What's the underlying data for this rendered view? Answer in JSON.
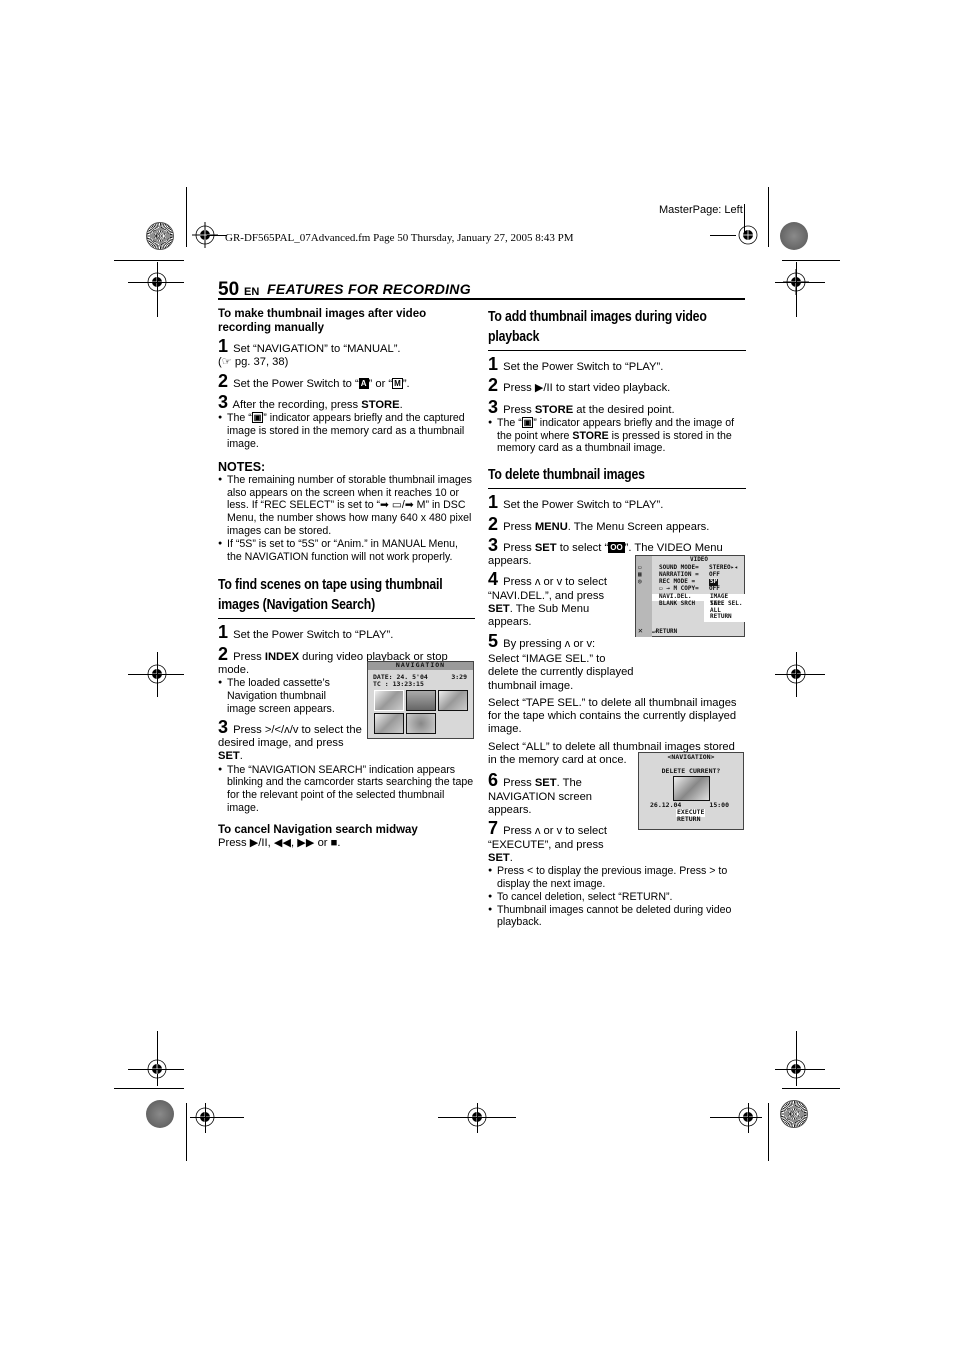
{
  "print_marks": {
    "masterpage": "MasterPage: Left",
    "file_info": "GR-DF565PAL_07Advanced.fm  Page 50  Thursday, January 27, 2005  8:43 PM"
  },
  "header": {
    "page_number": "50",
    "language": "EN",
    "section_title": "FEATURES FOR RECORDING"
  },
  "left_column": {
    "manual": {
      "title": "To make thumbnail images after video recording manually",
      "steps": [
        {
          "num": "1",
          "text": "Set “NAVIGATION” to “MANUAL”.",
          "ref": "(☞ pg. 37, 38)"
        },
        {
          "num": "2",
          "text_before": "Set the Power Switch to “",
          "icon1": "A",
          "text_mid": "” or “",
          "icon2": "M",
          "text_after": "”."
        },
        {
          "num": "3",
          "text_before": "After the recording, press ",
          "bold": "STORE",
          "text_after": "."
        }
      ],
      "bullet": {
        "text_before": "The “",
        "icon": "▣",
        "text_after": "” indicator appears briefly and the captured image is stored in the memory card as a thumbnail image."
      }
    },
    "notes": {
      "title": "NOTES:",
      "items": [
        "The remaining number of storable thumbnail images also appears on the screen when it reaches 10 or less. If “REC SELECT” is set to “➡ ▭/➡ M” in DSC Menu, the number shows how many 640 x 480 pixel images can be stored.",
        "If “5S” is set to “5S” or “Anim.” in MANUAL Menu, the NAVIGATION function will not work properly."
      ]
    },
    "navigation_search": {
      "title": "To find scenes on tape using thumbnail images (Navigation Search)",
      "step1": {
        "num": "1",
        "text": "Set the Power Switch to “PLAY”."
      },
      "step2": {
        "num": "2",
        "text_before": "Press ",
        "bold": "INDEX",
        "text_after": " during video playback or stop mode."
      },
      "bullet1": "The loaded cassette’s Navigation thumbnail image screen appears.",
      "step3": {
        "num": "3",
        "text_before": "Press >/</ʌ/v to select the desired image, and press ",
        "bold": "SET",
        "text_after": "."
      },
      "bullet2": "The “NAVIGATION SEARCH” indication appears blinking and the camcorder starts searching the tape for the relevant point of the selected thumbnail image.",
      "cancel_title": "To cancel Navigation search midway",
      "cancel_text": "Press ▶/II, ◀◀, ▶▶ or ■."
    },
    "nav_screen": {
      "title": "NAVIGATION",
      "date_label": "DATE: 24. 5'04",
      "time": "3:29",
      "tc_label": "TC  : 13:23:15"
    }
  },
  "right_column": {
    "add_during_playback": {
      "title": "To add thumbnail images during video playback",
      "steps": [
        {
          "num": "1",
          "text": "Set the Power Switch to “PLAY”."
        },
        {
          "num": "2",
          "text": "Press ▶/II to start video playback."
        },
        {
          "num": "3",
          "text_before": "Press ",
          "bold": "STORE",
          "text_after": " at the desired point."
        }
      ],
      "bullet": {
        "text_before": "The “",
        "icon": "▣",
        "text_mid": "” indicator appears briefly and the image of the point where ",
        "bold": "STORE",
        "text_after": " is pressed is stored in the memory card as a thumbnail image."
      }
    },
    "delete": {
      "title": "To delete thumbnail images",
      "step1": {
        "num": "1",
        "text": "Set the Power Switch to “PLAY”."
      },
      "step2": {
        "num": "2",
        "text_before": "Press ",
        "bold": "MENU",
        "text_after": ". The Menu Screen appears."
      },
      "step3": {
        "num": "3",
        "text_before": "Press ",
        "bold": "SET",
        "text_mid": " to select “",
        "icon": "OO",
        "text_after": "”. The VIDEO Menu appears."
      },
      "step4": {
        "num": "4",
        "text_before": "Press ʌ or v to select “NAVI.DEL.”, and press ",
        "bold": "SET",
        "text_after": ". The Sub Menu appears."
      },
      "step5": {
        "num": "5",
        "text": "By pressing ʌ or v:"
      },
      "option_image": "Select “IMAGE SEL.” to delete the currently displayed thumbnail image.",
      "option_tape": "Select “TAPE SEL.” to delete all thumbnail images for the tape which contains the currently displayed image.",
      "option_all": "Select “ALL” to delete all thumbnail images stored in the memory card at once.",
      "step6": {
        "num": "6",
        "text_before": "Press ",
        "bold": "SET",
        "text_after": ". The NAVIGATION screen appears."
      },
      "step7": {
        "num": "7",
        "text_before": "Press ʌ or v to select “EXECUTE”, and press ",
        "bold": "SET",
        "text_after": "."
      },
      "bullets": [
        "Press < to display the previous image. Press > to display the next image.",
        "To cancel deletion, select “RETURN”.",
        "Thumbnail images cannot be deleted during video playback."
      ]
    },
    "video_menu": {
      "title": "VIDEO",
      "rows": [
        {
          "label": "SOUND MODE",
          "sep": "=",
          "value": "STEREO▸◂"
        },
        {
          "label": "NARRATION",
          "sep": "=",
          "value": "OFF"
        },
        {
          "label": "REC MODE",
          "sep": "=",
          "value": "SP"
        },
        {
          "label": "▭ → M COPY",
          "sep": "=",
          "value": "OFF"
        },
        {
          "label": "NAVI.DEL.",
          "sep": "",
          "value": "IMAGE SEL."
        },
        {
          "label": "BLANK SRCH",
          "sep": "",
          "value": "TAPE SEL."
        }
      ],
      "submenu_extra": [
        "ALL",
        "RETURN"
      ],
      "footer": "↵RETURN",
      "close": "✕"
    },
    "delete_screen": {
      "title": "<NAVIGATION>",
      "prompt": "DELETE CURRENT?",
      "date": "26.12.04",
      "time": "15:00",
      "options": [
        "EXECUTE",
        "RETURN"
      ]
    }
  }
}
